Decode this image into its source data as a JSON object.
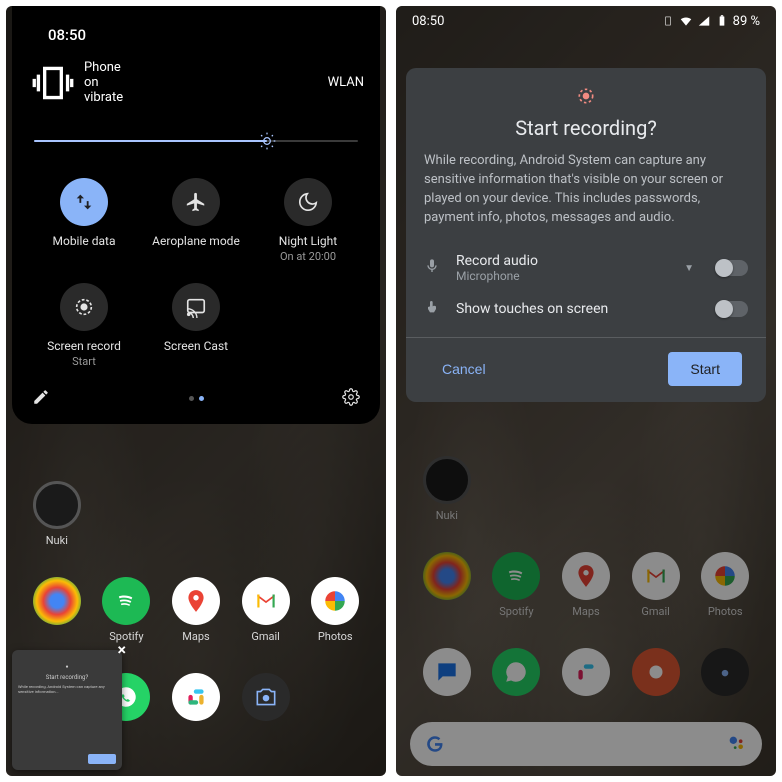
{
  "left": {
    "time": "08:50",
    "status_left": "Phone on vibrate",
    "status_right": "WLAN",
    "brightness_pct": 72,
    "tiles": [
      {
        "label": "Mobile data",
        "sub": "",
        "active": true,
        "icon": "mobile-data"
      },
      {
        "label": "Aeroplane mode",
        "sub": "",
        "active": false,
        "icon": "airplane"
      },
      {
        "label": "Night Light",
        "sub": "On at 20:00",
        "active": false,
        "icon": "moon"
      },
      {
        "label": "Screen record",
        "sub": "Start",
        "active": false,
        "icon": "record"
      },
      {
        "label": "Screen Cast",
        "sub": "",
        "active": false,
        "icon": "cast"
      }
    ],
    "apps": [
      "Nuki",
      "",
      "Spotify",
      "Maps",
      "Gmail",
      "Photos",
      "",
      "",
      "",
      "",
      ""
    ]
  },
  "right": {
    "time": "08:50",
    "battery": "89 %",
    "dialog": {
      "title": "Start recording?",
      "body": "While recording, Android System can capture any sensitive information that's visible on your screen or played on your device. This includes passwords, payment info, photos, messages and audio.",
      "row1_label": "Record audio",
      "row1_sub": "Microphone",
      "row2_label": "Show touches on screen",
      "cancel": "Cancel",
      "start": "Start"
    },
    "apps_row1": [
      "Nuki",
      "",
      "",
      "",
      ""
    ],
    "apps_row2_labels": [
      "",
      "Spotify",
      "Maps",
      "Gmail",
      "Photos"
    ]
  }
}
